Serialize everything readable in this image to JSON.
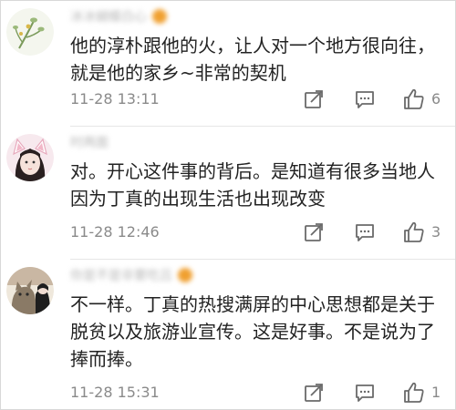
{
  "comments": [
    {
      "username": "冰冰蝴蝶白心",
      "text": "他的淳朴跟他的火，让人对一个地方很向往，就是他的家乡~非常的契机",
      "time": "11-28 13:11",
      "likes": "6",
      "avatar_icon": "flower-avatar-icon",
      "has_badge": true
    },
    {
      "username": "时两面",
      "text": "对。开心这件事的背后。是知道有很多当地人因为丁真的出现生活也出现改变",
      "time": "11-28 12:46",
      "likes": "3",
      "avatar_icon": "cat-ear-girl-avatar-icon",
      "has_badge": false
    },
    {
      "username": "你是不是非要吃吕",
      "text": "不一样。丁真的热搜满屏的中心思想都是关于脱贫以及旅游业宣传。这是好事。不是说为了捧而捧。",
      "time": "11-28 15:31",
      "likes": "1",
      "avatar_icon": "cat-photo-avatar-icon",
      "has_badge": true
    }
  ],
  "icons": {
    "share": "share-icon",
    "reply": "reply-icon",
    "like": "thumbs-up-icon"
  },
  "colors": {
    "meta_text": "#8a8a8a",
    "icon_stroke": "#6a6a6a",
    "body_text": "#222222",
    "badge": "#f0a030"
  }
}
